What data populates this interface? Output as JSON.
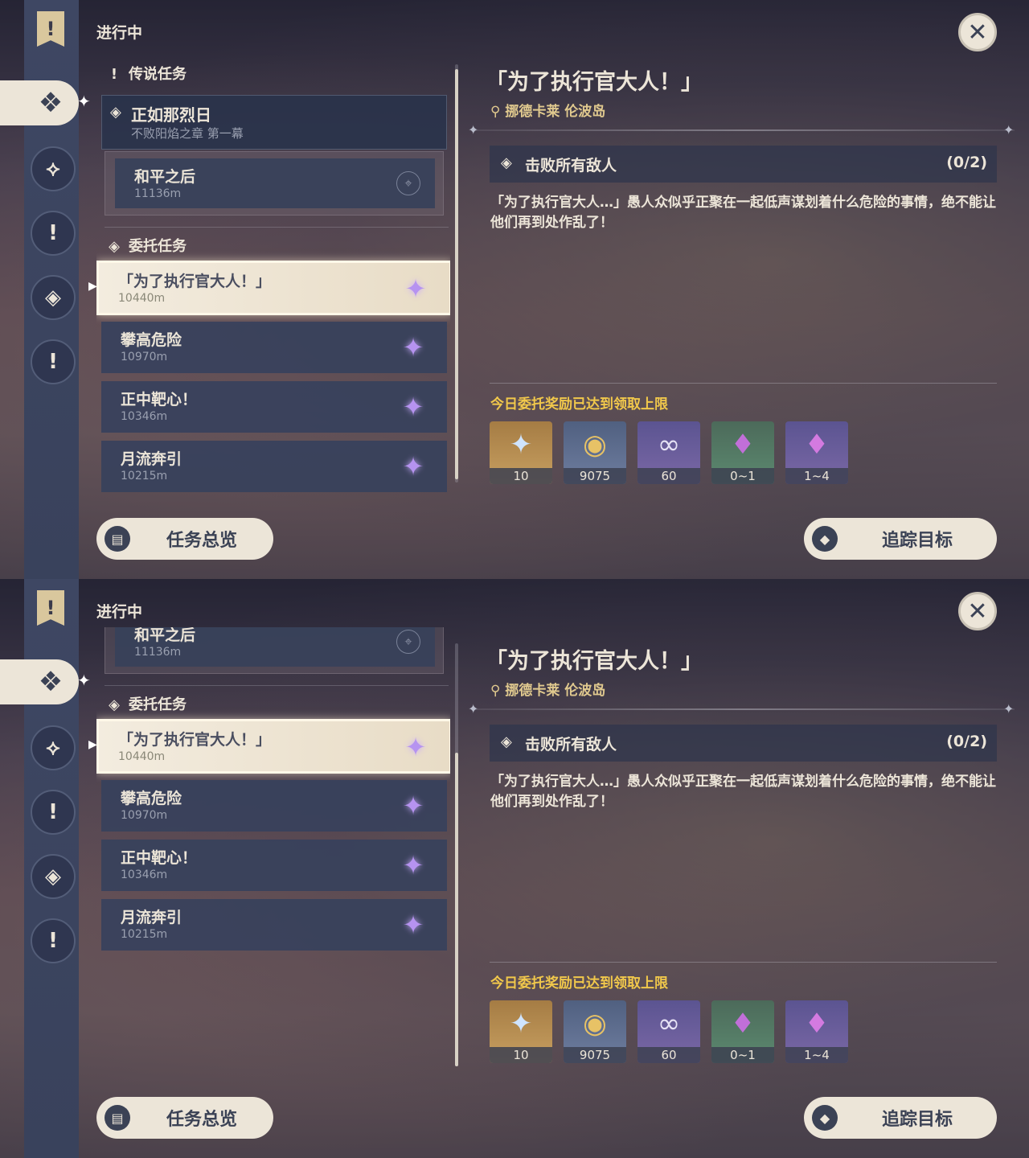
{
  "header": {
    "section": "进行中",
    "close_glyph": "✕"
  },
  "sidebar": {
    "icons": [
      {
        "name": "banner-icon",
        "glyph": "!"
      },
      {
        "name": "all-quests-icon",
        "glyph": "✦"
      },
      {
        "name": "archon-quest-icon",
        "glyph": "⟐"
      },
      {
        "name": "story-quest-icon",
        "glyph": "!"
      },
      {
        "name": "commission-icon",
        "glyph": "◈"
      },
      {
        "name": "world-quest-icon",
        "glyph": "!"
      }
    ]
  },
  "list": {
    "legend_category": "传说任务",
    "legend_item": {
      "title": "正如那烈日",
      "subtitle": "不败阳焰之章 第一幕"
    },
    "legend_sub": {
      "title": "和平之后",
      "distance": "11136m"
    },
    "commission_category": "委托任务",
    "quests": [
      {
        "title": "「为了执行官大人！」",
        "distance": "10440m"
      },
      {
        "title": "攀高危险",
        "distance": "10970m"
      },
      {
        "title": "正中靶心！",
        "distance": "10346m"
      },
      {
        "title": "月流奔引",
        "distance": "10215m"
      }
    ]
  },
  "detail": {
    "title": "「为了执行官大人！」",
    "location": "挪德卡莱 伦波岛",
    "objective": {
      "text": "击败所有敌人",
      "progress": "(0/2)"
    },
    "description": "「为了执行官大人…」愚人众似乎正聚在一起低声谋划着什么危险的事情，绝不能让他们再到处作乱了！",
    "reward_limit": "今日委托奖励已达到领取上限",
    "rewards": [
      {
        "name": "primogem",
        "count": "10",
        "glyph": "✦",
        "tone": "gold"
      },
      {
        "name": "mora",
        "count": "9075",
        "glyph": "◉",
        "tone": "blue"
      },
      {
        "name": "adventure-exp",
        "count": "60",
        "glyph": "∞",
        "tone": "purple"
      },
      {
        "name": "crystal-green",
        "count": "0~1",
        "glyph": "♦",
        "tone": "green"
      },
      {
        "name": "crystal-purple",
        "count": "1~4",
        "glyph": "♦",
        "tone": "purple"
      }
    ]
  },
  "buttons": {
    "overview": "任务总览",
    "track": "追踪目标"
  }
}
